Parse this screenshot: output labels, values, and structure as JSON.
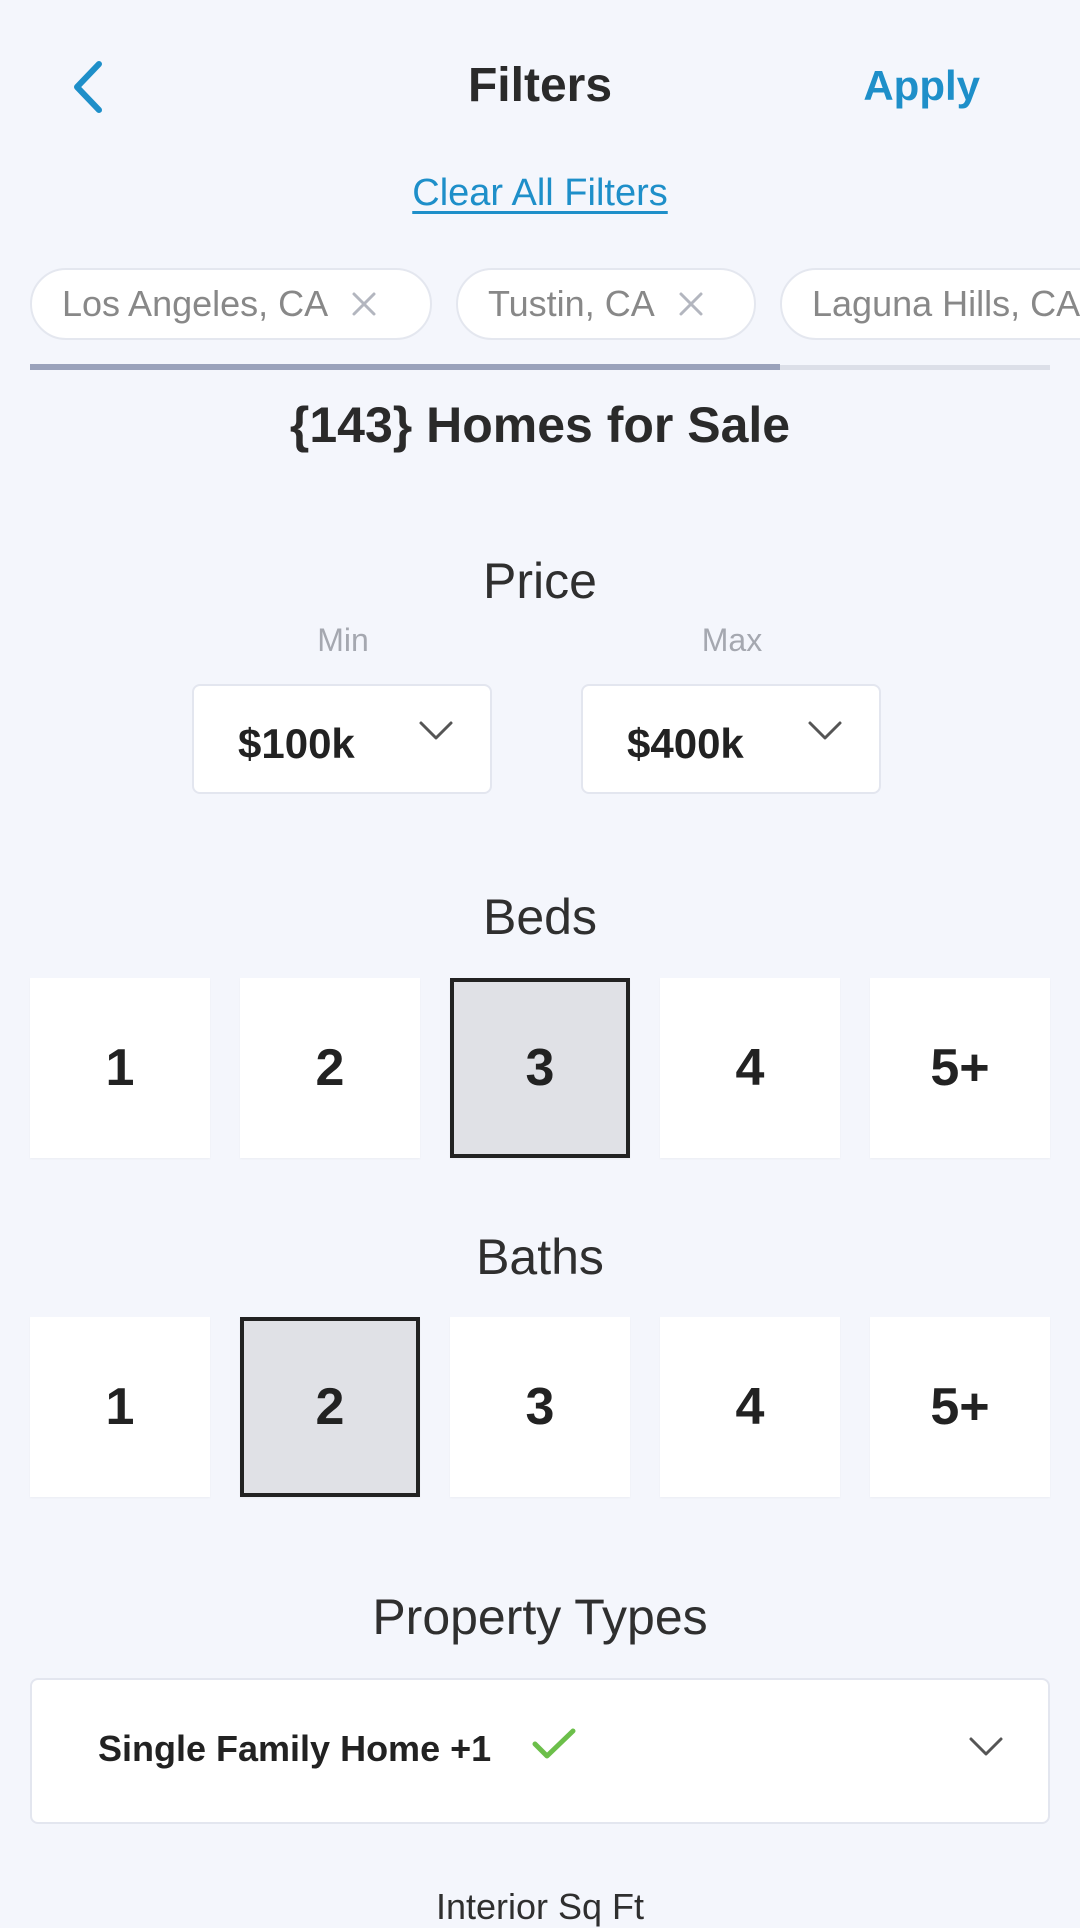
{
  "header": {
    "back_icon": "chevron-left-icon",
    "title": "Filters",
    "apply_label": "Apply",
    "clear_label": "Clear All Filters",
    "accent_color": "#1e8fc9"
  },
  "locations": [
    {
      "label": "Los Angeles, CA",
      "remove_icon": "close-icon"
    },
    {
      "label": "Tustin, CA",
      "remove_icon": "close-icon"
    },
    {
      "label": "Laguna Hills, CA",
      "remove_icon": "close-icon"
    }
  ],
  "results_count": "{143} Homes for Sale",
  "price": {
    "title": "Price",
    "min_label": "Min",
    "min_value": "$100k",
    "max_label": "Max",
    "max_value": "$400k"
  },
  "beds": {
    "title": "Beds",
    "options": [
      "1",
      "2",
      "3",
      "4",
      "5+"
    ],
    "selected": "3"
  },
  "baths": {
    "title": "Baths",
    "options": [
      "1",
      "2",
      "3",
      "4",
      "5+"
    ],
    "selected": "2"
  },
  "property_types": {
    "title": "Property Types",
    "value": "Single Family Home +1",
    "check_icon": "check-icon",
    "check_color": "#6cbf4a"
  },
  "interior_sqft": {
    "title": "Interior Sq Ft"
  }
}
